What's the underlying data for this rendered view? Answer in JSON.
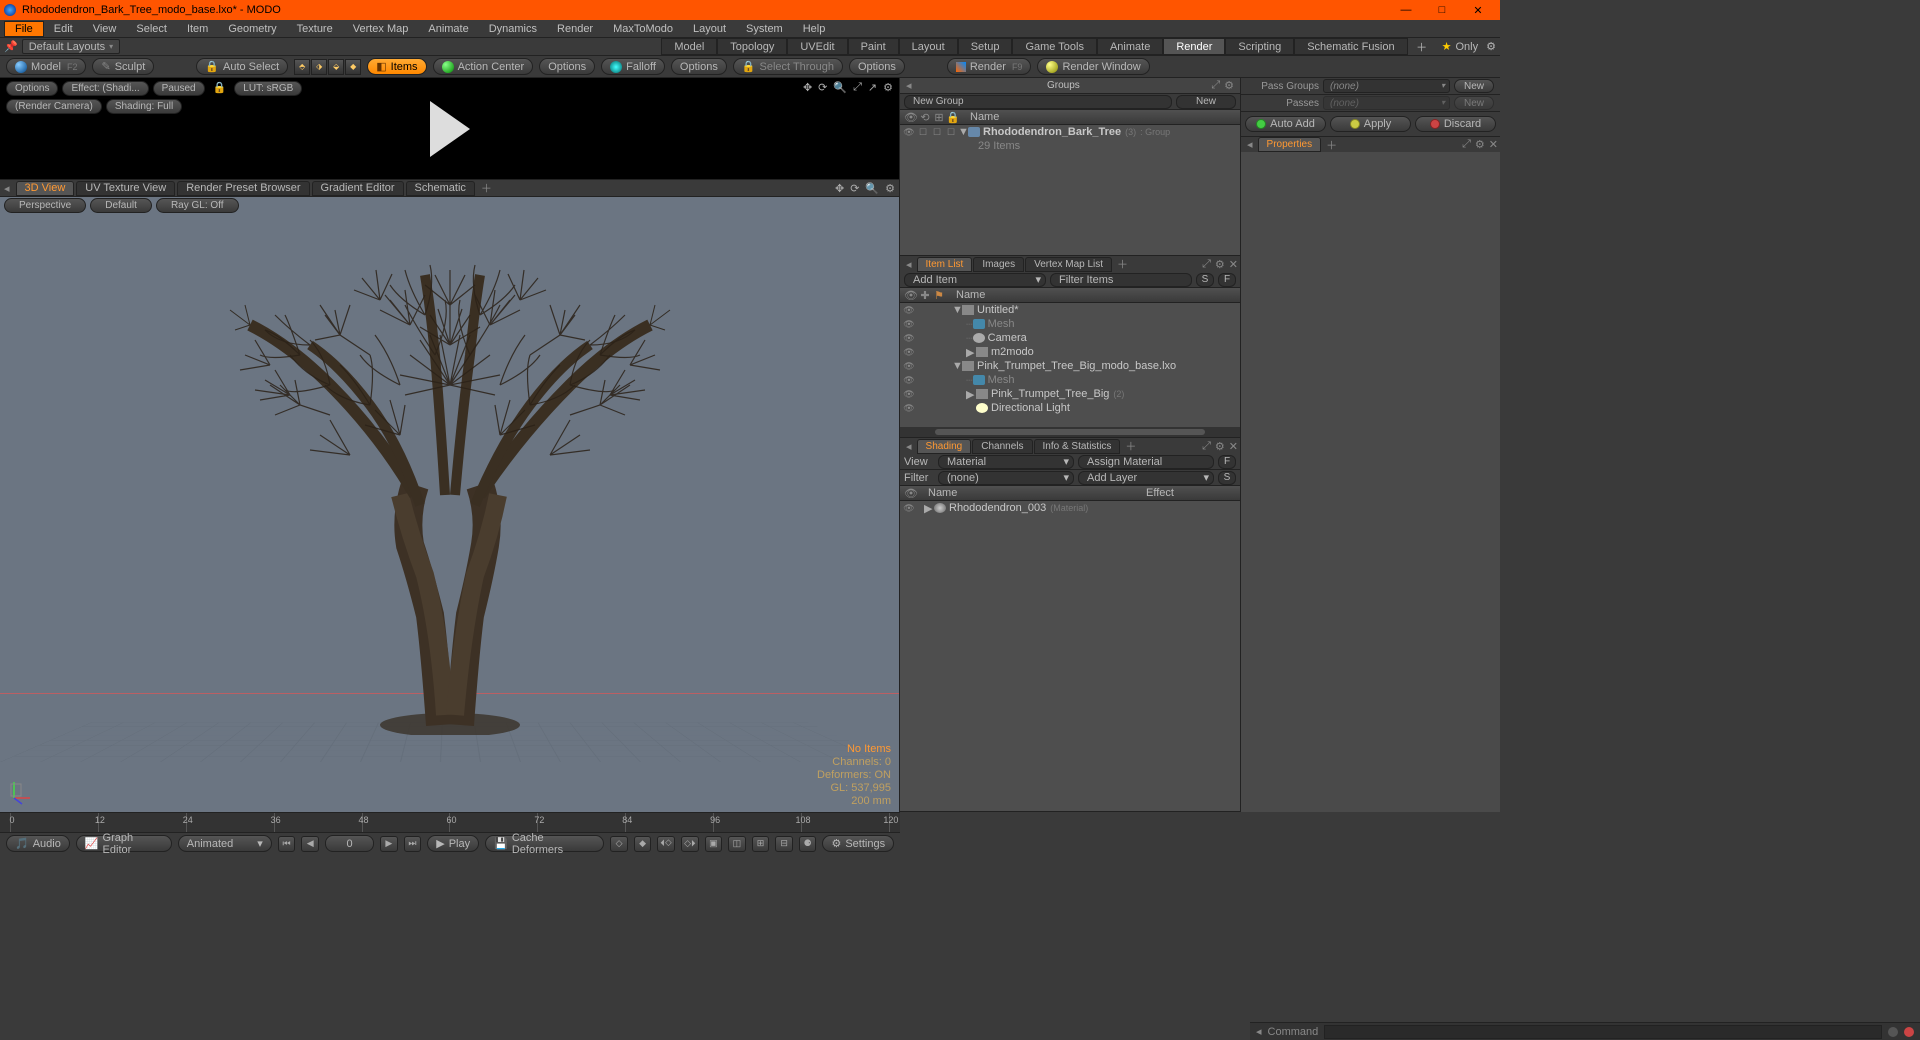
{
  "app": {
    "title": "Rhododendron_Bark_Tree_modo_base.lxo* - MODO",
    "win": {
      "min": "—",
      "max": "□",
      "close": "✕"
    }
  },
  "menu": [
    "File",
    "Edit",
    "View",
    "Select",
    "Item",
    "Geometry",
    "Texture",
    "Vertex Map",
    "Animate",
    "Dynamics",
    "Render",
    "MaxToModo",
    "Layout",
    "System",
    "Help"
  ],
  "menu_active": "File",
  "layoutbar": {
    "layout_dd": "Default Layouts",
    "tabs": [
      "Model",
      "Topology",
      "UVEdit",
      "Paint",
      "Layout",
      "Setup",
      "Game Tools",
      "Animate",
      "Render",
      "Scripting",
      "Schematic Fusion"
    ],
    "active": "Render",
    "only": "Only"
  },
  "toolbar": {
    "model": "Model",
    "model_f": "F2",
    "sculpt": "Sculpt",
    "autoselect": "Auto Select",
    "items": "Items",
    "actioncenter": "Action Center",
    "options1": "Options",
    "falloff": "Falloff",
    "options2": "Options",
    "select_through": "Select Through",
    "options3": "Options",
    "render": "Render",
    "render_f": "F9",
    "renderwindow": "Render Window"
  },
  "preview": {
    "row1": {
      "options": "Options",
      "effect": "Effect: (Shadi...",
      "paused": "Paused",
      "lut": "LUT: sRGB"
    },
    "row2": {
      "cam": "(Render Camera)",
      "shade": "Shading: Full"
    }
  },
  "viewtabs": [
    "3D View",
    "UV Texture View",
    "Render Preset Browser",
    "Gradient Editor",
    "Schematic"
  ],
  "viewtabs_active": "3D View",
  "vpbar": {
    "persp": "Perspective",
    "default": "Default",
    "raygl": "Ray GL: Off"
  },
  "vpinfo": {
    "noitems": "No Items",
    "channels": "Channels: 0",
    "deformers": "Deformers: ON",
    "gl": "GL: 537,995",
    "scale": "200 mm"
  },
  "groups": {
    "title": "Groups",
    "newgroup": "New Group",
    "new": "New",
    "name_col": "Name",
    "root": {
      "name": "Rhododendron_Bark_Tree",
      "suffix": "(3)",
      "type": ": Group",
      "items": "29 Items"
    }
  },
  "itemlist": {
    "tabs": [
      "Item List",
      "Images",
      "Vertex Map List"
    ],
    "active": "Item List",
    "additem": "Add Item",
    "filter": "Filter Items",
    "name_col": "Name",
    "tree": [
      {
        "exp": "▼",
        "icon": "scene",
        "name": "Untitled*",
        "indent": 0
      },
      {
        "exp": "",
        "icon": "mesh",
        "name": "Mesh",
        "indent": 1,
        "dim": true,
        "dash": true
      },
      {
        "exp": "",
        "icon": "cam",
        "name": "Camera",
        "indent": 1,
        "dash": true
      },
      {
        "exp": "▶",
        "icon": "item",
        "name": "m2modo",
        "indent": 1
      },
      {
        "exp": "▼",
        "icon": "scene",
        "name": "Pink_Trumpet_Tree_Big_modo_base.lxo",
        "indent": 0
      },
      {
        "exp": "",
        "icon": "mesh",
        "name": "Mesh",
        "indent": 1,
        "dim": true,
        "dash": true
      },
      {
        "exp": "▶",
        "icon": "item",
        "name": "Pink_Trumpet_Tree_Big",
        "suffix": "(2)",
        "indent": 1
      },
      {
        "exp": "",
        "icon": "light",
        "name": "Directional Light",
        "indent": 1
      }
    ]
  },
  "shading": {
    "tabs": [
      "Shading",
      "Channels",
      "Info & Statistics"
    ],
    "active": "Shading",
    "view_lbl": "View",
    "view_val": "Material",
    "assign": "Assign Material",
    "filter_lbl": "Filter",
    "filter_val": "(none)",
    "addlayer": "Add Layer",
    "name_col": "Name",
    "effect_col": "Effect",
    "row": {
      "name": "Rhododendron_003",
      "suffix": "(Material)"
    }
  },
  "farcol": {
    "passgroups_lbl": "Pass Groups",
    "passgroups_val": "(none)",
    "passgroups_new": "New",
    "passes_lbl": "Passes",
    "passes_val": "(none)",
    "passes_new": "New",
    "autoadd": "Auto Add",
    "apply": "Apply",
    "discard": "Discard",
    "properties": "Properties"
  },
  "timeline": {
    "major": [
      "0",
      "12",
      "24",
      "36",
      "48",
      "60",
      "72",
      "84",
      "96",
      "108",
      "120"
    ],
    "minor": [
      "0",
      "24",
      "48",
      "72",
      "96",
      "120"
    ]
  },
  "bottombar": {
    "audio": "Audio",
    "grapheditor": "Graph Editor",
    "animated": "Animated",
    "frame": "0",
    "play": "Play",
    "cache": "Cache Deformers",
    "settings": "Settings"
  },
  "cmdbar": {
    "label": "Command"
  }
}
